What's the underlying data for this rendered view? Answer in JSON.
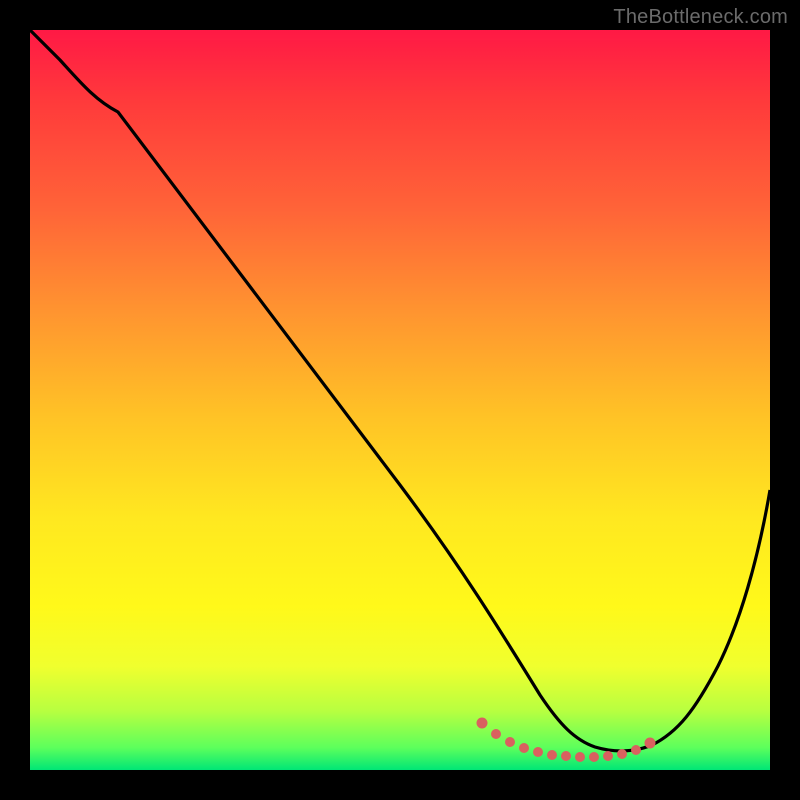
{
  "watermark": "TheBottleneck.com",
  "colors": {
    "background": "#000000",
    "curve": "#000000",
    "dots": "#d9615f"
  },
  "chart_data": {
    "type": "line",
    "title": "",
    "xlabel": "",
    "ylabel": "",
    "xlim": [
      0,
      100
    ],
    "ylim": [
      0,
      100
    ],
    "series": [
      {
        "name": "bottleneck-curve",
        "x": [
          0,
          4,
          8,
          12,
          20,
          30,
          40,
          50,
          58,
          62,
          66,
          70,
          74,
          78,
          82,
          86,
          90,
          95,
          100
        ],
        "y": [
          100,
          96,
          93,
          89,
          79,
          66,
          52,
          39,
          28,
          21,
          14,
          8,
          4,
          3,
          3,
          4,
          9,
          22,
          38
        ]
      }
    ],
    "annotations": {
      "dotted_segment_x_range": [
        60,
        84
      ],
      "dotted_segment_description": "highlighted minimum region near bottom of curve"
    }
  }
}
